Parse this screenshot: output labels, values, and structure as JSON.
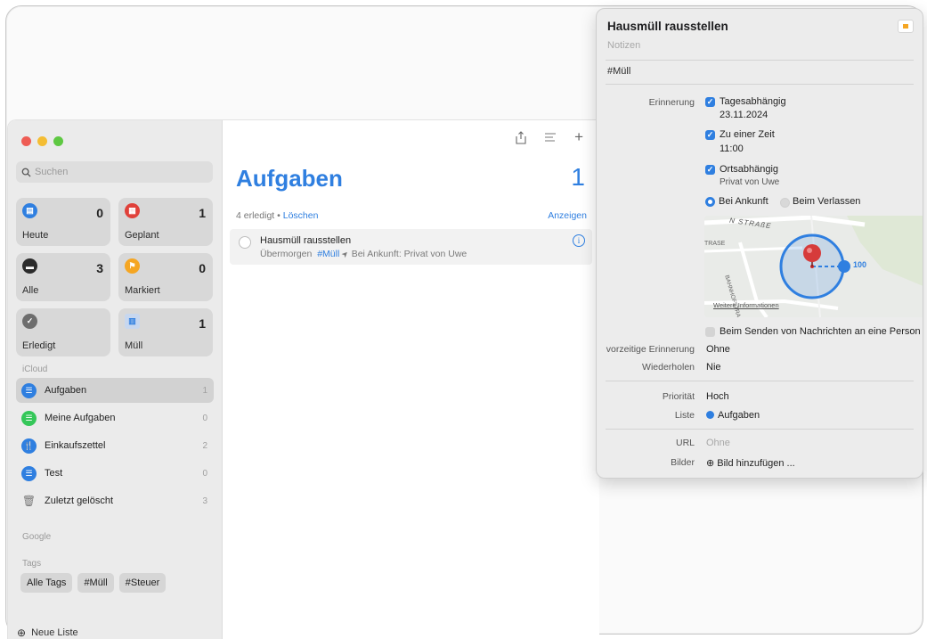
{
  "sidebar": {
    "search_placeholder": "Suchen",
    "smart_lists": [
      {
        "label": "Heute",
        "count": "0",
        "icon": "calendar-icon",
        "color": "#2f7fe0"
      },
      {
        "label": "Geplant",
        "count": "1",
        "icon": "calendar-grid-icon",
        "color": "#e0413a"
      },
      {
        "label": "Alle",
        "count": "3",
        "icon": "tray-icon",
        "color": "#3a3a3a"
      },
      {
        "label": "Markiert",
        "count": "0",
        "icon": "flag-icon",
        "color": "#f5a623"
      },
      {
        "label": "Erledigt",
        "count": "",
        "icon": "checkmark-icon",
        "color": "#6e6e6e"
      },
      {
        "label": "Müll",
        "count": "1",
        "icon": "trash-list-icon",
        "color": "#2f7fe0"
      }
    ],
    "icloud_label": "iCloud",
    "lists": [
      {
        "label": "Aufgaben",
        "count": "1",
        "color": "#2f7fe0",
        "icon": "list-bullet-icon"
      },
      {
        "label": "Meine Aufgaben",
        "count": "0",
        "color": "#35c759",
        "icon": "list-bullet-icon"
      },
      {
        "label": "Einkaufszettel",
        "count": "2",
        "color": "#2f7fe0",
        "icon": "fork-knife-icon"
      },
      {
        "label": "Test",
        "count": "0",
        "color": "#2f7fe0",
        "icon": "list-bullet-icon"
      },
      {
        "label": "Zuletzt gelöscht",
        "count": "3",
        "color": "#9a9a9a",
        "icon": "trash-icon"
      }
    ],
    "google_label": "Google",
    "tags_label": "Tags",
    "tags": [
      "Alle Tags",
      "#Müll",
      "#Steuer"
    ],
    "new_list": "Neue Liste"
  },
  "main": {
    "title": "Aufgaben",
    "count": "1",
    "done_text": "4 erledigt",
    "separator": "•",
    "delete_link": "Löschen",
    "show_link": "Anzeigen",
    "task": {
      "title": "Hausmüll rausstellen",
      "date": "Übermorgen",
      "tag": "#Müll",
      "location": "Bei Ankunft: Privat von Uwe"
    }
  },
  "popover": {
    "title": "Hausmüll rausstellen",
    "notes_placeholder": "Notizen",
    "tag": "#Müll",
    "reminder_label": "Erinnerung",
    "day_based": "Tagesabhängig",
    "date": "23.11.2024",
    "at_time": "Zu einer Zeit",
    "time": "11:00",
    "location_based": "Ortsabhängig",
    "location_name": "Privat von Uwe",
    "on_arrival": "Bei Ankunft",
    "on_leaving": "Beim Verlassen",
    "map_street1": "N STRAßE",
    "map_street2": "TRASE",
    "map_street3": "BAHNHOFSTRAßE",
    "map_more_info": "Weitere Informationen",
    "map_radius": "100",
    "messaging": "Beim Senden von Nachrichten an eine Person",
    "early_label": "vorzeitige Erinnerung",
    "early_value": "Ohne",
    "repeat_label": "Wiederholen",
    "repeat_value": "Nie",
    "priority_label": "Priorität",
    "priority_value": "Hoch",
    "list_label": "Liste",
    "list_value": "Aufgaben",
    "url_label": "URL",
    "url_value": "Ohne",
    "images_label": "Bilder",
    "images_value": "Bild hinzufügen ..."
  }
}
